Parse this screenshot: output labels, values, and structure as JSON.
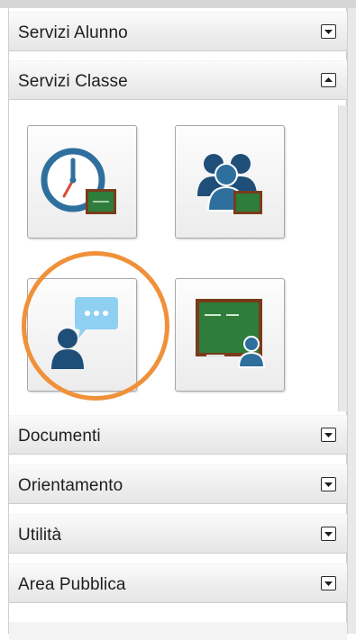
{
  "sections": [
    {
      "label": "Servizi Alunno",
      "state": "collapsed",
      "toggle_icon": "expand-down"
    },
    {
      "label": "Servizi Classe",
      "state": "expanded",
      "toggle_icon": "collapse-up"
    },
    {
      "label": "Documenti",
      "state": "collapsed",
      "toggle_icon": "expand-down"
    },
    {
      "label": "Orientamento",
      "state": "collapsed",
      "toggle_icon": "expand-down"
    },
    {
      "label": "Utilità",
      "state": "collapsed",
      "toggle_icon": "expand-down"
    },
    {
      "label": "Area Pubblica",
      "state": "collapsed",
      "toggle_icon": "expand-down"
    }
  ],
  "servizi_classe_tiles": [
    {
      "icon": "clock-blackboard-icon"
    },
    {
      "icon": "group-blackboard-icon"
    },
    {
      "icon": "user-chat-bubble-icon",
      "highlighted": true
    },
    {
      "icon": "blackboard-teacher-icon"
    }
  ],
  "colors": {
    "icon_blue": "#2f6f9e",
    "icon_dark_blue": "#1f4e79",
    "chat_blue": "#8fd0f2",
    "board_green": "#2e7d3a",
    "board_frame": "#7a3b1c",
    "highlight_orange": "#f0913a"
  }
}
